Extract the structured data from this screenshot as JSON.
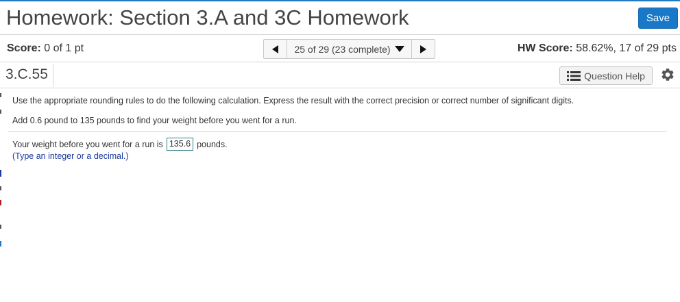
{
  "header": {
    "title": "Homework: Section 3.A and 3C Homework",
    "save_label": "Save"
  },
  "score_bar": {
    "score_label": "Score:",
    "score_value": "0 of 1 pt",
    "nav_label": "25 of 29 (23 complete)",
    "hw_score_label": "HW Score:",
    "hw_score_value": "58.62%, 17 of 29 pts"
  },
  "question_bar": {
    "question_id": "3.C.55",
    "help_label": "Question Help"
  },
  "content": {
    "instructions": "Use the appropriate rounding rules to do the following calculation. Express the result with the correct precision or correct number of significant digits.",
    "task": "Add 0.6 pound to 135 pounds to find your weight before you went for a run.",
    "answer_prefix": "Your weight before you went for a run is",
    "answer_value": "135.6",
    "answer_suffix": "pounds.",
    "hint": "(Type an integer or a decimal.)"
  },
  "colors": {
    "accent": "#1a78c8",
    "hint_text": "#1a3a9c",
    "answer_border": "#2a7b86"
  },
  "icons": {
    "prev": "triangle-left-icon",
    "next": "triangle-right-icon",
    "dropdown": "triangle-down-icon",
    "help": "list-icon",
    "settings": "gear-icon"
  }
}
